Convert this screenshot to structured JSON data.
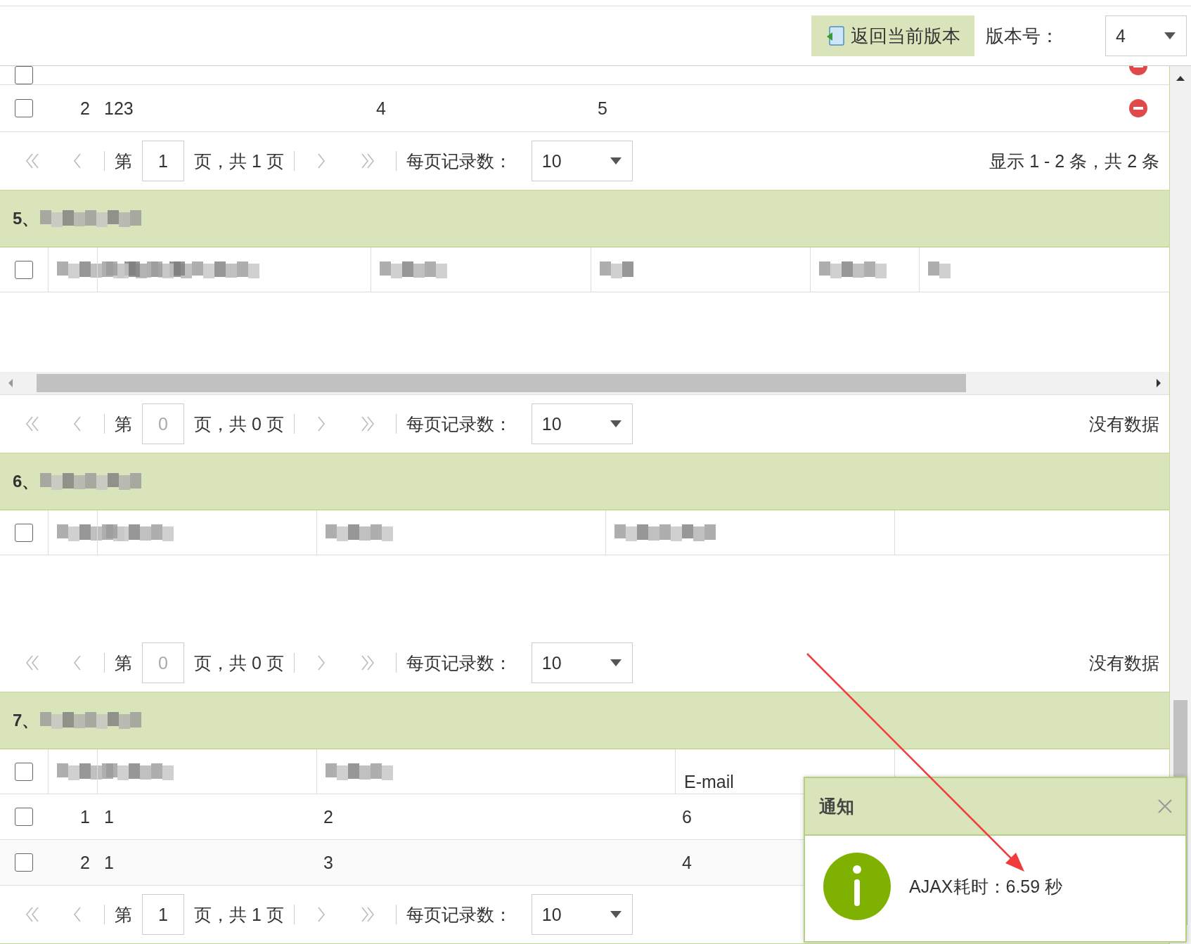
{
  "toolbar": {
    "restore_button": "返回当前版本",
    "version_label": "版本号：",
    "version_value": "4"
  },
  "top_table": {
    "cut_row": {
      "checked": false,
      "deletable": true
    },
    "rows": [
      {
        "checked": false,
        "index": "2",
        "cells": [
          "123",
          "4",
          "5"
        ],
        "deletable": true
      }
    ],
    "pager": {
      "page_prefix": "第",
      "page": "1",
      "page_disabled": false,
      "page_suffix": "页，共 1 页",
      "page_size_label": "每页记录数：",
      "page_size": "10",
      "summary": "显示 1 - 2 条，共 2 条"
    }
  },
  "sections": [
    {
      "title": "5、",
      "title_blurred": true,
      "header_checked": false,
      "columns": [
        {
          "blurred": true
        },
        {
          "blurred": true
        },
        {
          "blurred": true
        },
        {
          "blurred": true
        },
        {
          "blurred": true
        },
        {
          "blurred": true
        }
      ],
      "h_scrollbar": true,
      "pager": {
        "page_prefix": "第",
        "page": "0",
        "page_disabled": true,
        "page_suffix": "页，共 0 页",
        "page_size_label": "每页记录数：",
        "page_size": "10",
        "summary": "没有数据"
      }
    },
    {
      "title": "6、",
      "title_blurred": true,
      "header_checked": false,
      "columns": [
        {
          "blurred": true
        },
        {
          "blurred": true
        },
        {
          "blurred": true
        },
        {
          "blurred": true
        }
      ],
      "pager": {
        "page_prefix": "第",
        "page": "0",
        "page_disabled": true,
        "page_suffix": "页，共 0 页",
        "page_size_label": "每页记录数：",
        "page_size": "10",
        "summary": "没有数据"
      }
    },
    {
      "title": "7、",
      "title_blurred": true,
      "header_checked": false,
      "columns": [
        {
          "blurred": true
        },
        {
          "blurred": true
        },
        {
          "blurred": true
        },
        {
          "label": "E-mail"
        }
      ],
      "rows": [
        {
          "checked": false,
          "index": "1",
          "cells": [
            "1",
            "2",
            "6"
          ]
        },
        {
          "checked": false,
          "index": "2",
          "cells": [
            "1",
            "3",
            "4"
          ]
        }
      ],
      "pager": {
        "page_prefix": "第",
        "page": "1",
        "page_disabled": false,
        "page_suffix": "页，共 1 页",
        "page_size_label": "每页记录数：",
        "page_size": "10"
      }
    }
  ],
  "notification": {
    "title": "通知",
    "message": "AJAX耗时：6.59 秒"
  }
}
